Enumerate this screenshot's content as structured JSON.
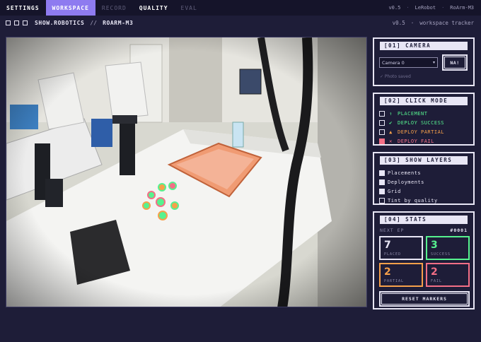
{
  "nav": {
    "tabs": [
      {
        "label": "SETTINGS",
        "state": "normal"
      },
      {
        "label": "WORKSPACE",
        "state": "active"
      },
      {
        "label": "RECORD",
        "state": "disabled"
      },
      {
        "label": "QUALITY",
        "state": "normal"
      },
      {
        "label": "EVAL",
        "state": "disabled"
      }
    ],
    "right": [
      "v0.5",
      "·",
      "LeRobot",
      "·",
      "RoArm-M3"
    ]
  },
  "subbar": {
    "brand": "SHOW.ROBOTICS",
    "separator": "//",
    "robot": "ROARM-M3",
    "version": "v0.5",
    "dot": "·",
    "mode": "workspace tracker"
  },
  "camera_panel": {
    "title": "[01] CAMERA",
    "select_value": "Camera 0",
    "button_label": "NA!",
    "status": "✓ Photo saved"
  },
  "click_mode": {
    "title": "[02] CLICK MODE",
    "items": [
      {
        "icon": "↑",
        "label": "PLACEMENT",
        "color": "#56f28f",
        "state": "empty"
      },
      {
        "icon": "✔",
        "label": "DEPLOY SUCCESS",
        "color": "#56f28f",
        "state": "empty"
      },
      {
        "icon": "▲",
        "label": "DEPLOY PARTIAL",
        "color": "#f6a04a",
        "state": "empty"
      },
      {
        "icon": "✕",
        "label": "DEPLOY FAIL",
        "color": "#f36f86",
        "state": "selected"
      }
    ]
  },
  "show_layers": {
    "title": "[03] SHOW LAYERS",
    "items": [
      {
        "label": "Placements",
        "checked": true
      },
      {
        "label": "Deployments",
        "checked": true
      },
      {
        "label": "Grid",
        "checked": true
      },
      {
        "label": "Tint by quality",
        "checked": false
      }
    ]
  },
  "stats": {
    "title": "[04] STATS",
    "next_ep_label": "NEXT EP",
    "next_ep_value": "#0001",
    "cards": [
      {
        "value": "7",
        "label": "PLACED",
        "color": "#e8e6f5"
      },
      {
        "value": "3",
        "label": "SUCCESS",
        "color": "#56f28f"
      },
      {
        "value": "2",
        "label": "PARTIAL",
        "color": "#f6a04a"
      },
      {
        "value": "2",
        "label": "FAIL",
        "color": "#f36f86"
      }
    ],
    "reset_label": "RESET MARKERS"
  },
  "colors": {
    "background": "#1e1d38",
    "accent": "#8e7bf0",
    "success": "#56f28f",
    "partial": "#f6a04a",
    "fail": "#f36f86"
  }
}
